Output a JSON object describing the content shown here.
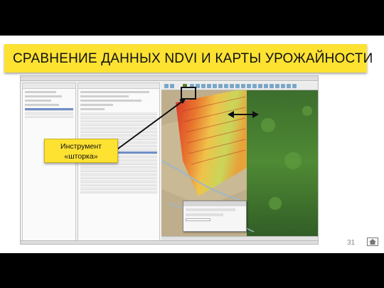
{
  "slide": {
    "title": "СРАВНЕНИЕ ДАННЫХ NDVI И КАРТЫ УРОЖАЙНОСТИ",
    "callout": {
      "line1": "Инструмент",
      "line2": "«шторка»"
    },
    "page_number": "31"
  },
  "colors": {
    "banner": "#fde232",
    "callout": "#fde232",
    "highlight_box": "#111111",
    "arrow": "#111111"
  },
  "icons": [
    "curtain-tool-icon",
    "double-arrow-icon",
    "home-icon"
  ]
}
